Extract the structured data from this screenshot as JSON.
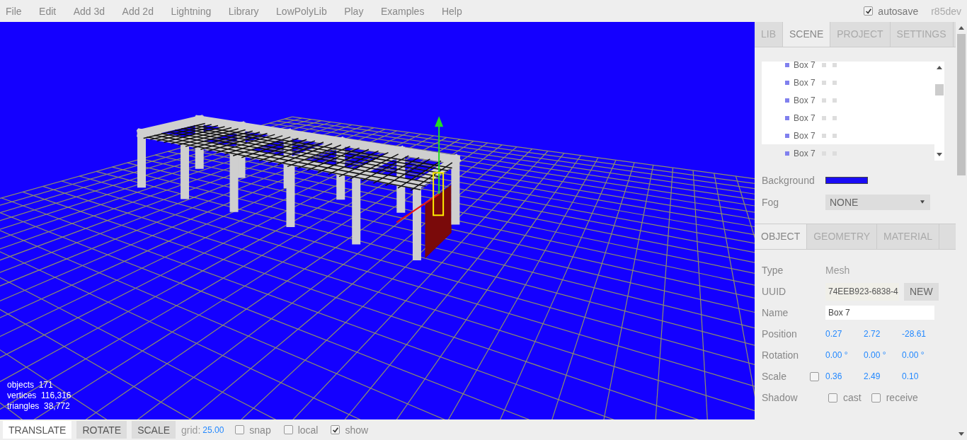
{
  "menu": [
    "File",
    "Edit",
    "Add 3d",
    "Add 2d",
    "Lightning",
    "Library",
    "LowPolyLib",
    "Play",
    "Examples",
    "Help"
  ],
  "autosave": {
    "label": "autosave",
    "checked": true
  },
  "version": "r85dev",
  "viewport": {
    "stats": [
      {
        "label": "objects",
        "value": "171"
      },
      {
        "label": "vertices",
        "value": "116,316"
      },
      {
        "label": "triangles",
        "value": "38,772"
      }
    ]
  },
  "sidebar_tabs": [
    {
      "label": "LIB",
      "selected": false
    },
    {
      "label": "SCENE",
      "selected": true
    },
    {
      "label": "PROJECT",
      "selected": false
    },
    {
      "label": "SETTINGS",
      "selected": false
    }
  ],
  "outliner": [
    {
      "label": "Box 7",
      "selected": false
    },
    {
      "label": "Box 7",
      "selected": false
    },
    {
      "label": "Box 7",
      "selected": false
    },
    {
      "label": "Box 7",
      "selected": false
    },
    {
      "label": "Box 7",
      "selected": false
    },
    {
      "label": "Box 7",
      "selected": true
    }
  ],
  "background": {
    "label": "Background",
    "color": "#1a0cf5"
  },
  "fog": {
    "label": "Fog",
    "value": "NONE"
  },
  "object_tabs": [
    {
      "label": "OBJECT",
      "selected": true
    },
    {
      "label": "GEOMETRY",
      "selected": false
    },
    {
      "label": "MATERIAL",
      "selected": false
    }
  ],
  "properties": [
    {
      "kind": "text",
      "label": "Type",
      "value": "Mesh"
    },
    {
      "kind": "uuid",
      "label": "UUID",
      "value": "74EEB923-6838-4",
      "button": "NEW"
    },
    {
      "kind": "field",
      "label": "Name",
      "value": "Box 7"
    },
    {
      "kind": "vector",
      "label": "Position",
      "values": [
        "0.27",
        "2.72",
        "-28.61"
      ]
    },
    {
      "kind": "vector",
      "label": "Rotation",
      "values": [
        "0.00 °",
        "0.00 °",
        "0.00 °"
      ]
    },
    {
      "kind": "vector",
      "label": "Scale",
      "checked": false,
      "values": [
        "0.36",
        "2.49",
        "0.10"
      ]
    },
    {
      "kind": "checks",
      "label": "Shadow",
      "options": [
        {
          "label": "cast",
          "checked": false
        },
        {
          "label": "receive",
          "checked": false
        }
      ]
    }
  ],
  "toolbar": {
    "modes": [
      {
        "label": "TRANSLATE",
        "selected": true
      },
      {
        "label": "ROTATE",
        "selected": false
      },
      {
        "label": "SCALE",
        "selected": false
      }
    ],
    "grid_label": "grid:",
    "grid_value": "25.00",
    "options": [
      {
        "label": "snap",
        "checked": false
      },
      {
        "label": "local",
        "checked": false
      },
      {
        "label": "show",
        "checked": true
      }
    ]
  }
}
